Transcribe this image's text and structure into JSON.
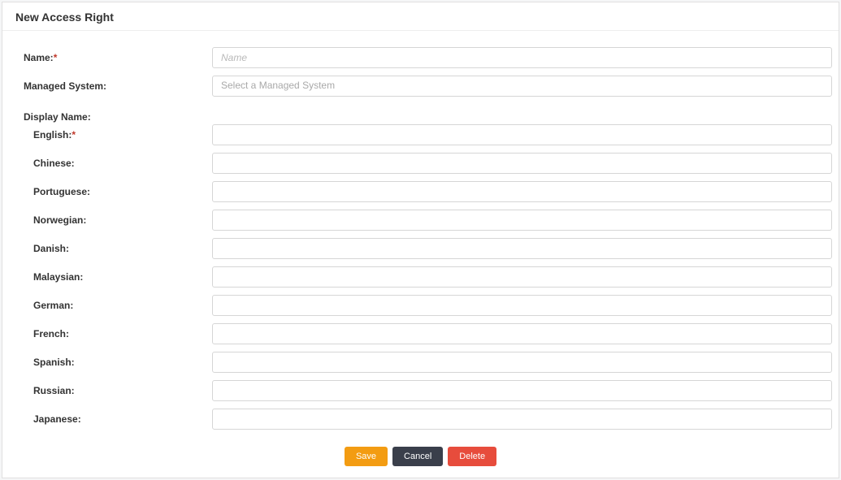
{
  "panel": {
    "title": "New Access Right"
  },
  "form": {
    "name": {
      "label": "Name:",
      "required": "*",
      "placeholder": "Name",
      "value": ""
    },
    "managedSystem": {
      "label": "Managed System:",
      "placeholder": "Select a Managed System",
      "value": ""
    },
    "displayName": {
      "sectionLabel": "Display Name:",
      "languages": [
        {
          "label": "English:",
          "required": "*",
          "value": ""
        },
        {
          "label": "Chinese:",
          "required": "",
          "value": ""
        },
        {
          "label": "Portuguese:",
          "required": "",
          "value": ""
        },
        {
          "label": "Norwegian:",
          "required": "",
          "value": ""
        },
        {
          "label": "Danish:",
          "required": "",
          "value": ""
        },
        {
          "label": "Malaysian:",
          "required": "",
          "value": ""
        },
        {
          "label": "German:",
          "required": "",
          "value": ""
        },
        {
          "label": "French:",
          "required": "",
          "value": ""
        },
        {
          "label": "Spanish:",
          "required": "",
          "value": ""
        },
        {
          "label": "Russian:",
          "required": "",
          "value": ""
        },
        {
          "label": "Japanese:",
          "required": "",
          "value": ""
        }
      ]
    }
  },
  "buttons": {
    "save": "Save",
    "cancel": "Cancel",
    "delete": "Delete"
  }
}
